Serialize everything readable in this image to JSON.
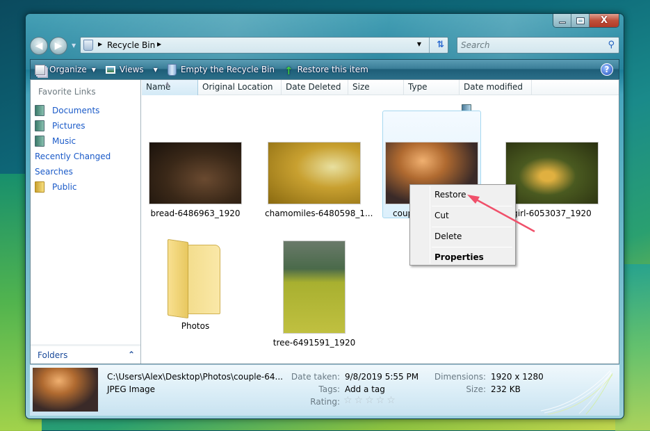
{
  "window": {
    "caption_buttons": {
      "minimize": "minimize",
      "maximize": "maximize",
      "close": "X"
    }
  },
  "nav": {
    "back_icon": "back-arrow-icon",
    "forward_icon": "forward-arrow-icon",
    "address_crumb": "Recycle Bin",
    "search_placeholder": "Search"
  },
  "toolbar": {
    "organize": "Organize",
    "views": "Views",
    "empty_bin": "Empty the Recycle Bin",
    "restore_item": "Restore this item",
    "help": "?"
  },
  "sidebar": {
    "title": "Favorite Links",
    "items": [
      {
        "label": "Documents",
        "icon": "documents-icon"
      },
      {
        "label": "Pictures",
        "icon": "pictures-icon"
      },
      {
        "label": "Music",
        "icon": "music-icon"
      },
      {
        "label": "Recently Changed",
        "icon": "recently-changed-icon"
      },
      {
        "label": "Searches",
        "icon": "searches-icon"
      },
      {
        "label": "Public",
        "icon": "public-folder-icon"
      }
    ],
    "folders_label": "Folders"
  },
  "columns": [
    "Name",
    "Original Location",
    "Date Deleted",
    "Size",
    "Type",
    "Date modified"
  ],
  "files": [
    {
      "name": "bread-6486963_1920",
      "kind": "image"
    },
    {
      "name": "chamomiles-6480598_1...",
      "kind": "image"
    },
    {
      "name": "coup",
      "kind": "image",
      "selected": true
    },
    {
      "name": "girl-6053037_1920",
      "kind": "image"
    },
    {
      "name": "Photos",
      "kind": "folder"
    },
    {
      "name": "tree-6491591_1920",
      "kind": "image"
    }
  ],
  "context_menu": {
    "items": [
      "Restore",
      "Cut",
      "Delete",
      "Properties"
    ]
  },
  "details": {
    "path": "C:\\Users\\Alex\\Desktop\\Photos\\couple-64...",
    "type": "JPEG Image",
    "date_taken_label": "Date taken:",
    "date_taken": "9/8/2019 5:55 PM",
    "tags_label": "Tags:",
    "tags": "Add a tag",
    "rating_label": "Rating:",
    "rating_stars": "☆☆☆☆☆",
    "rating_value": 0,
    "dimensions_label": "Dimensions:",
    "dimensions": "1920 x 1280",
    "size_label": "Size:",
    "size": "232 KB"
  },
  "colors": {
    "link_blue": "#1a5ac8",
    "annotation_arrow": "#f0506a",
    "selection_border": "#a6d8f0"
  }
}
